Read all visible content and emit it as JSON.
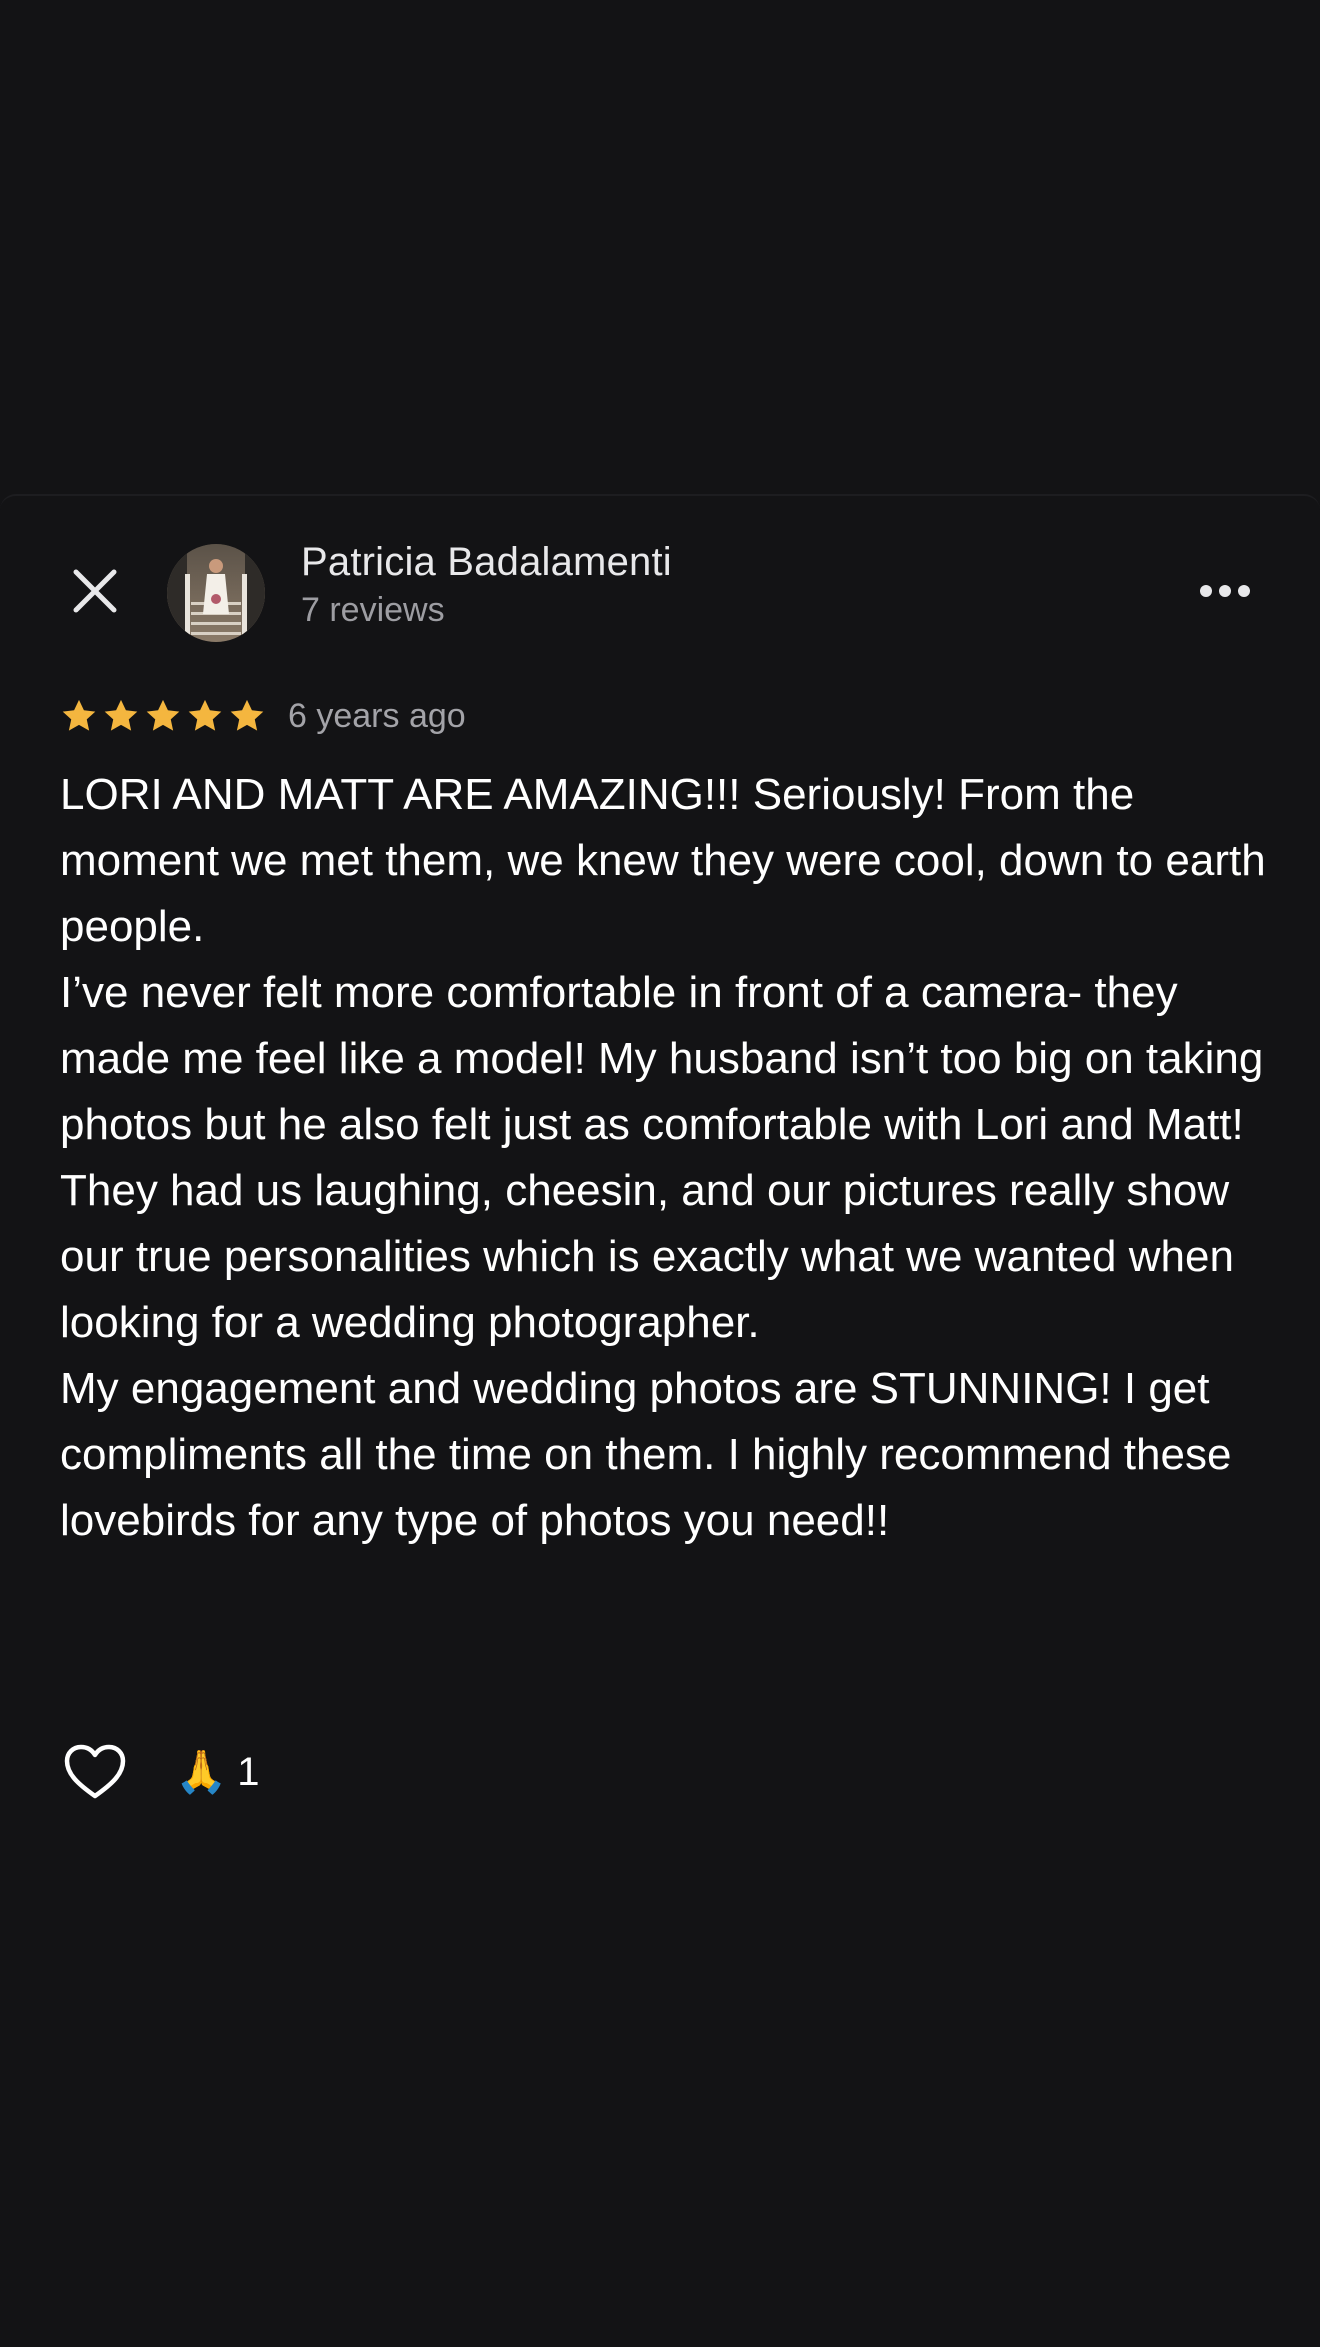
{
  "review": {
    "author_name": "Patricia Badalamenti",
    "author_review_count": "7 reviews",
    "rating": 5,
    "rating_max": 5,
    "date": "6 years ago",
    "paragraphs": [
      "LORI AND MATT ARE AMAZING!!! Seriously! From the moment we met them, we knew they were cool, down to earth people.",
      "I’ve never felt more comfortable in front of a camera- they made me feel like a model! My husband isn’t too big on taking photos but he also felt just as comfortable with Lori and Matt! They had us laughing, cheesin, and our pictures really show our true personalities which is exactly what we wanted when looking for a wedding photographer.",
      "My engagement and wedding photos are STUNNING! I get compliments all the time on them. I highly recommend these lovebirds for any type of photos you need!!"
    ]
  },
  "reactions": {
    "like_icon": "heart-outline-icon",
    "emoji": "🙏",
    "count": "1"
  },
  "icons": {
    "close": "close-icon",
    "more": "more-horizontal-icon",
    "star": "star-icon"
  },
  "colors": {
    "background": "#131315",
    "star": "#f4b63f",
    "text_primary": "#ffffff",
    "text_secondary": "#9d9da2"
  }
}
